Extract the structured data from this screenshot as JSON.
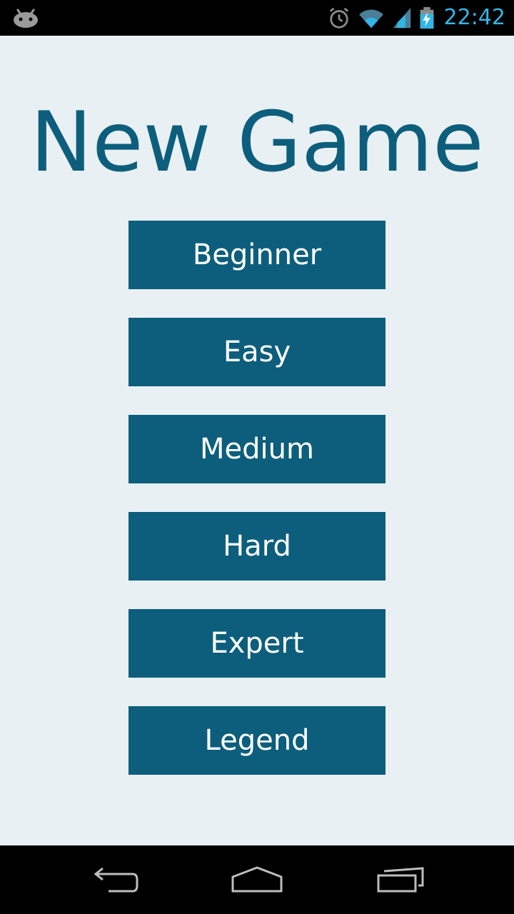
{
  "status_bar": {
    "time": "22:42",
    "icons": [
      "android-debug-icon",
      "alarm-icon",
      "wifi-icon",
      "signal-icon",
      "battery-charging-icon"
    ],
    "clock_color": "#33b5e5"
  },
  "screen": {
    "title": "New Game",
    "background": "#e8f0f3",
    "accent": "#0d5e7c"
  },
  "difficulties": [
    {
      "label": "Beginner"
    },
    {
      "label": "Easy"
    },
    {
      "label": "Medium"
    },
    {
      "label": "Hard"
    },
    {
      "label": "Expert"
    },
    {
      "label": "Legend"
    }
  ],
  "nav_bar": {
    "buttons": [
      "back-icon",
      "home-icon",
      "recent-apps-icon"
    ]
  }
}
